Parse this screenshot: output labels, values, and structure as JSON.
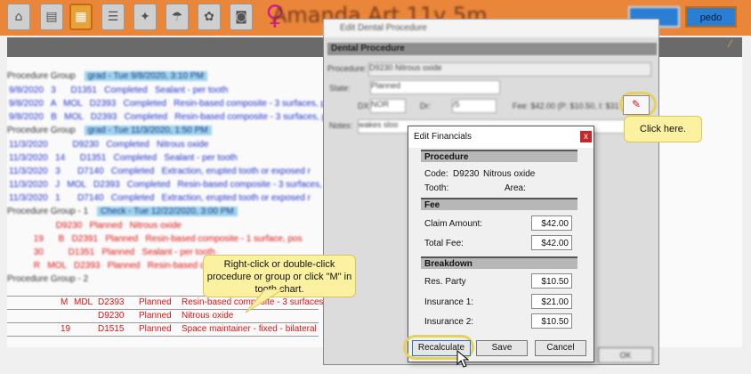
{
  "toolbar": {
    "icons": [
      "home-icon",
      "document-icon",
      "chart-icon",
      "form-icon",
      "tooth-icon",
      "umbrella-icon",
      "pills-icon",
      "camera-icon"
    ],
    "patient_name": "Amanda Art 11y 5m",
    "buttons": [
      "",
      "pedo"
    ]
  },
  "background_list": {
    "rows": [
      {
        "kind": "group",
        "label": "Procedure Group",
        "tag": "grad - Tue 9/8/2020, 3:10 PM"
      },
      {
        "kind": "blue",
        "text": "9/8/2020   3      D1351   Completed   Sealant - per tooth"
      },
      {
        "kind": "blue",
        "text": "9/8/2020   A   MOL   D2393   Completed   Resin-based composite - 3 surfaces, po"
      },
      {
        "kind": "blue",
        "text": "9/8/2020   B   MOL   D2393   Completed   Resin-based composite - 3 surfaces, po"
      },
      {
        "kind": "group",
        "label": "Procedure Group",
        "tag": "grad - Tue 11/3/2020, 1:50 PM"
      },
      {
        "kind": "blue",
        "text": "11/3/2020          D9230   Completed   Nitrous oxide"
      },
      {
        "kind": "blue",
        "text": "11/3/2020   14      D1351   Completed   Sealant - per tooth"
      },
      {
        "kind": "blue",
        "text": "11/3/2020   3       D7140   Completed   Extraction, erupted tooth or exposed r"
      },
      {
        "kind": "blue",
        "text": "11/3/2020   J   MOL   D2393   Completed   Resin-based composite - 3 surfaces, po"
      },
      {
        "kind": "blue",
        "text": "11/3/2020   1       D7140   Completed   Extraction, erupted tooth or exposed r"
      },
      {
        "kind": "group",
        "label": "Procedure Group - 1",
        "tag": "Check - Tue 12/22/2020, 3:00 PM"
      },
      {
        "kind": "red",
        "text": "                   D9230   Planned   Nitrous oxide"
      },
      {
        "kind": "red",
        "text": "          19      B   D2391   Planned   Resin-based composite - 1 surface, pos"
      },
      {
        "kind": "red",
        "text": "          30          D1351   Planned   Sealant - per tooth"
      },
      {
        "kind": "red",
        "text": "          R   MOL   D2393   Planned   Resin-based composite - 3 surfaces"
      },
      {
        "kind": "group",
        "label": "Procedure Group - 2",
        "tag": ""
      }
    ],
    "sharp_rows": [
      {
        "tooth": "M",
        "surf": "MDL",
        "code": "D2393",
        "status": "Planned",
        "desc": "Resin-based composite - 3 surfaces, po"
      },
      {
        "tooth": "",
        "surf": "",
        "code": "D9230",
        "status": "Planned",
        "desc": "Nitrous oxide"
      },
      {
        "tooth": "19",
        "surf": "",
        "code": "D1515",
        "status": "Planned",
        "desc": "Space maintainer - fixed - bilateral"
      }
    ]
  },
  "dental_dialog": {
    "title": "Edit Dental Procedure",
    "section": "Dental Procedure",
    "procedure_label": "Procedure:",
    "procedure_value": "D9230  Nitrous oxide",
    "state_label": "State:",
    "state_value": "Planned",
    "dt_label": "DX:",
    "dt_value": "NOR",
    "dr_label": "Dr:",
    "dr_value": "/5",
    "fee_text": "Fee: $42.00 (P: $10.50, I: $31",
    "notes_label": "Notes:",
    "notes_value": "wakes sloo",
    "ok_label": "OK"
  },
  "callouts": {
    "click_here": "Click here.",
    "right_click": "Right-click or double-click procedure or group or click \"M\" in tooth chart."
  },
  "financials": {
    "title": "Edit Financials",
    "close": "x",
    "procedure_header": "Procedure",
    "code_label": "Code:",
    "code_value": "D9230",
    "code_desc": "Nitrous oxide",
    "tooth_label": "Tooth:",
    "area_label": "Area:",
    "fee_header": "Fee",
    "claim_label": "Claim Amount:",
    "claim_value": "$42.00",
    "total_label": "Total Fee:",
    "total_value": "$42.00",
    "breakdown_header": "Breakdown",
    "res_label": "Res. Party",
    "res_value": "$10.50",
    "ins1_label": "Insurance 1:",
    "ins1_value": "$21.00",
    "ins2_label": "Insurance 2:",
    "ins2_value": "$10.50",
    "recalc_label": "Recalculate",
    "save_label": "Save",
    "cancel_label": "Cancel"
  },
  "colors": {
    "toolbar_bg": "#e9863a",
    "planned_red": "#e01414",
    "completed_blue": "#2233cc",
    "callout_yellow": "#fbf1a0"
  }
}
